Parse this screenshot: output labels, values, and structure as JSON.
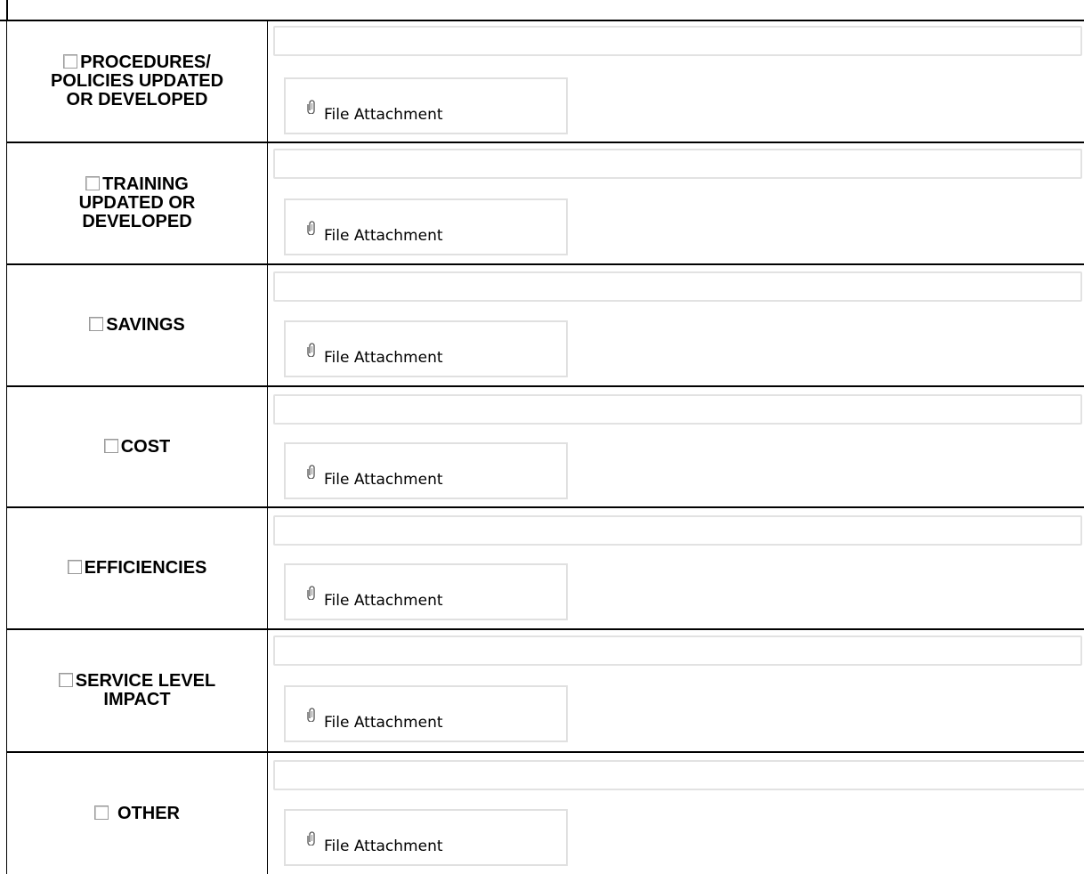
{
  "form": {
    "rows": [
      {
        "label": "PROCEDURES/ POLICIES UPDATED OR DEVELOPED",
        "checked": false,
        "text_value": "",
        "attachment_label": "File Attachment"
      },
      {
        "label": "TRAINING UPDATED OR DEVELOPED",
        "checked": false,
        "text_value": "",
        "attachment_label": "File Attachment"
      },
      {
        "label": "SAVINGS",
        "checked": false,
        "text_value": "",
        "attachment_label": "File Attachment"
      },
      {
        "label": "COST",
        "checked": false,
        "text_value": "",
        "attachment_label": "File Attachment"
      },
      {
        "label": "EFFICIENCIES",
        "checked": false,
        "text_value": "",
        "attachment_label": "File Attachment"
      },
      {
        "label": "SERVICE LEVEL IMPACT",
        "checked": false,
        "text_value": "",
        "attachment_label": "File Attachment"
      },
      {
        "label": "OTHER",
        "checked": false,
        "text_value": "",
        "attachment_label": "File Attachment"
      }
    ]
  },
  "icons": {
    "attachment": "paperclip-icon",
    "checkbox": "checkbox-icon"
  },
  "colors": {
    "border": "#000000",
    "field_border": "#e2e2e2",
    "checkbox_border": "#9a9a9a"
  }
}
